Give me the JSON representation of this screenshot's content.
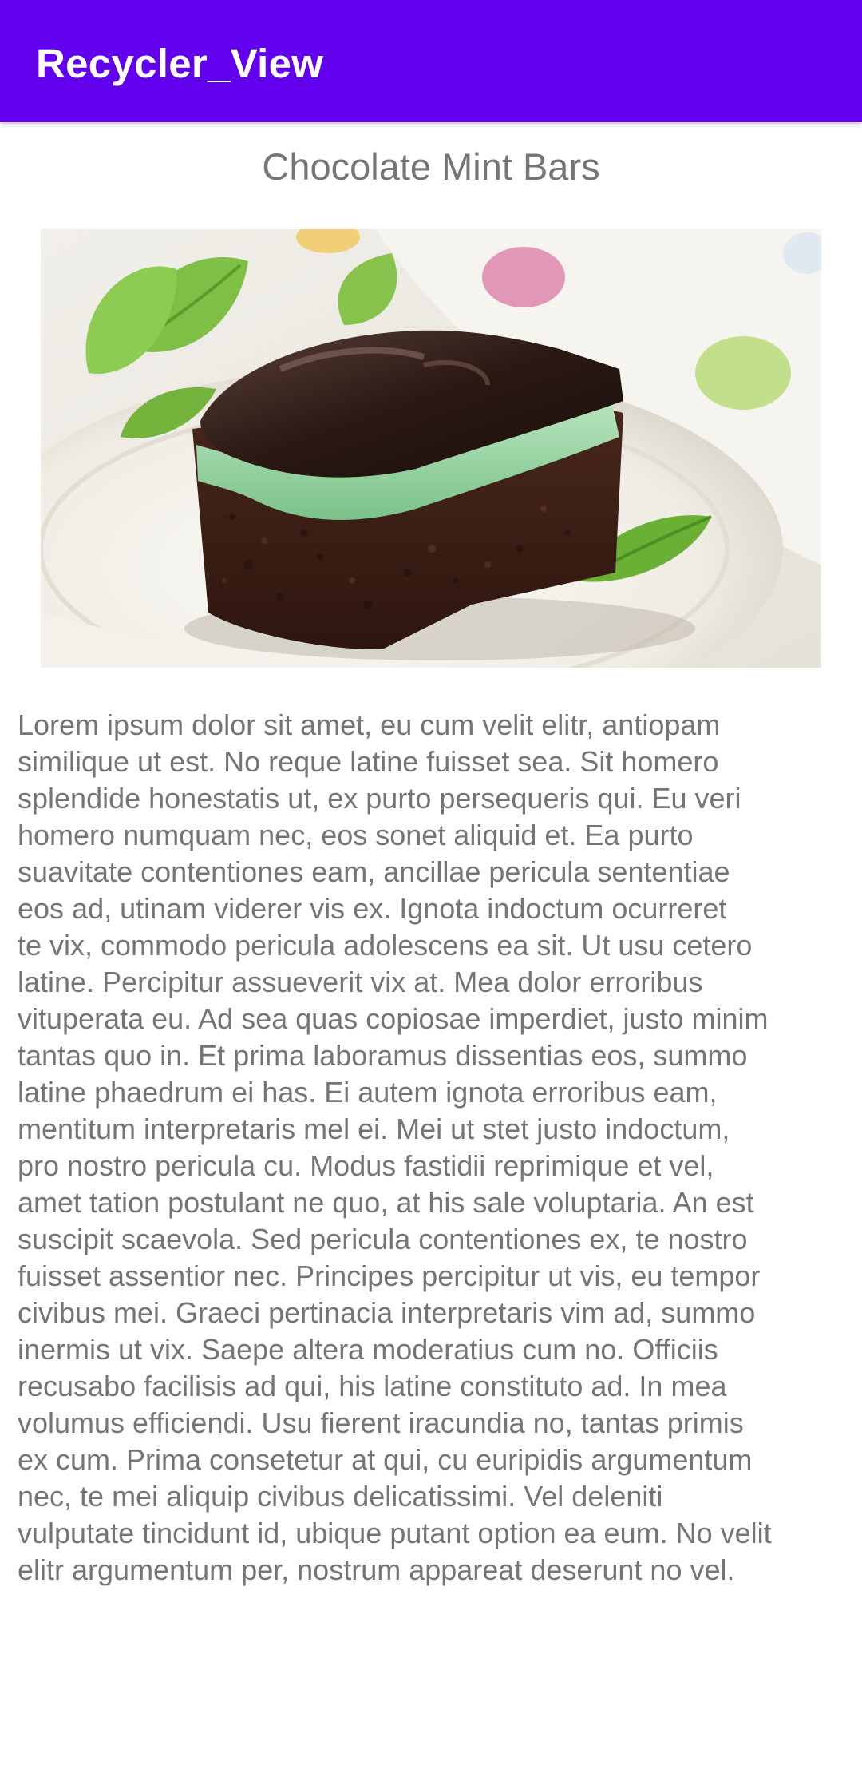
{
  "app_bar": {
    "title": "Recycler_View",
    "color": "#6200ee"
  },
  "recipe": {
    "title": "Chocolate Mint Bars",
    "image_icon": "chocolate-mint-bar-photo",
    "description": "Lorem ipsum dolor sit amet, eu cum velit elitr, antiopam\nsimilique ut est. No reque latine fuisset sea. Sit homero\nsplendide honestatis ut, ex purto persequeris qui. Eu veri\nhomero numquam nec, eos sonet aliquid et. Ea purto\nsuavitate contentiones eam, ancillae pericula sententiae\neos ad, utinam viderer vis ex. Ignota indoctum ocurreret\nte vix, commodo pericula adolescens ea sit. Ut usu cetero\nlatine. Percipitur assueverit vix at. Mea dolor erroribus\nvituperata eu. Ad sea quas copiosae imperdiet, justo minim\ntantas quo in. Et prima laboramus dissentias eos, summo\nlatine phaedrum ei has. Ei autem ignota erroribus eam,\nmentitum interpretaris mel ei. Mei ut stet justo indoctum,\npro nostro pericula cu. Modus fastidii reprimique et vel,\namet tation postulant ne quo, at his sale voluptaria. An est\nsuscipit scaevola. Sed pericula contentiones ex, te nostro\nfuisset assentior nec. Principes percipitur ut vis, eu tempor\ncivibus mei. Graeci pertinacia interpretaris vim ad, summo\ninermis ut vix. Saepe altera moderatius cum no. Officiis\nrecusabo facilisis ad qui, his latine constituto ad. In mea\nvolumus efficiendi. Usu fierent iracundia no, tantas primis\nex cum. Prima consetetur at qui, cu euripidis argumentum\nnec, te mei aliquip civibus delicatissimi. Vel deleniti\nvulputate tincidunt id, ubique putant option ea eum. No velit\nelitr argumentum per, nostrum appareat deserunt no vel."
  }
}
